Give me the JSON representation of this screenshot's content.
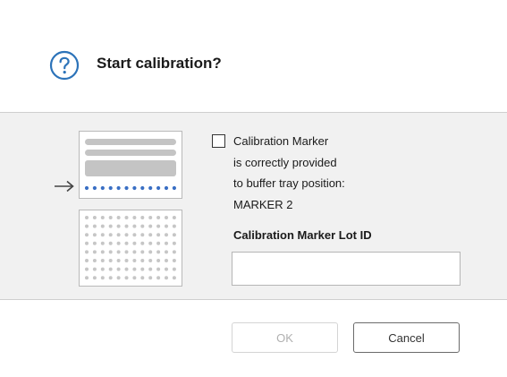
{
  "dialog": {
    "title": "Start calibration?",
    "icon": "question-circle-icon",
    "accent_color": "#2c73b9"
  },
  "illustration": {
    "arrow_icon": "arrow-right-icon",
    "marker_dot_color": "#3a6fc4",
    "plate_dot_color": "#c6c6c6"
  },
  "confirmation": {
    "checked": false,
    "lines": [
      "Calibration Marker",
      "is correctly provided",
      "to buffer tray position:",
      "MARKER 2"
    ]
  },
  "lot_id": {
    "label": "Calibration Marker Lot ID",
    "value": ""
  },
  "buttons": {
    "ok_label": "OK",
    "ok_enabled": false,
    "cancel_label": "Cancel"
  }
}
